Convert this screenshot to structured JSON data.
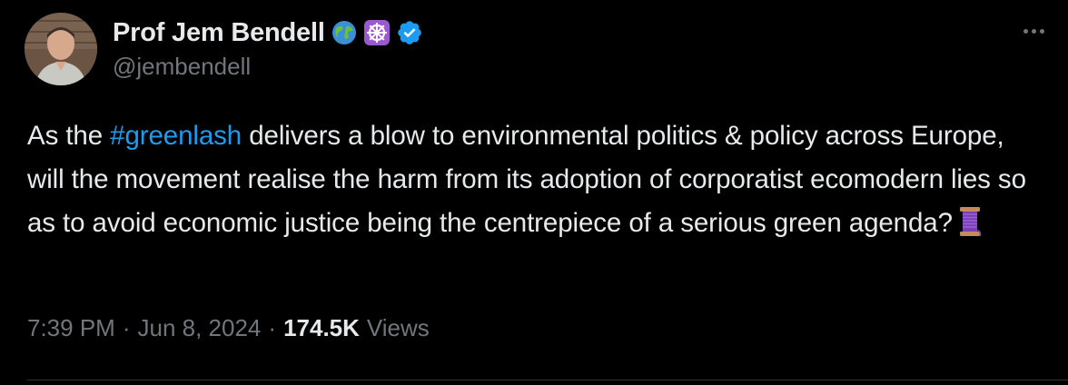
{
  "author": {
    "display_name": "Prof Jem Bendell",
    "handle": "@jembendell",
    "badges": [
      "globe-emoji-icon",
      "wheel-of-dharma-emoji-icon",
      "verified-badge-icon"
    ]
  },
  "tweet": {
    "text_before_hashtag": "As the ",
    "hashtag": "#greenlash",
    "text_after_hashtag": " delivers a blow to environmental politics & policy across Europe, will the movement realise the harm from its adoption of corporatist ecomodern lies so as to avoid economic justice being the centrepiece of a serious green agenda?",
    "trailing_emoji": "thread-spool-emoji-icon"
  },
  "meta": {
    "time": "7:39 PM",
    "date": "Jun 8, 2024",
    "separator": "·",
    "views_count": "174.5K",
    "views_label": "Views"
  },
  "colors": {
    "background": "#000000",
    "text": "#e7e9ea",
    "secondary": "#71767b",
    "link": "#1d9bf0",
    "verified": "#1d9bf0",
    "divider": "#2f3336"
  }
}
